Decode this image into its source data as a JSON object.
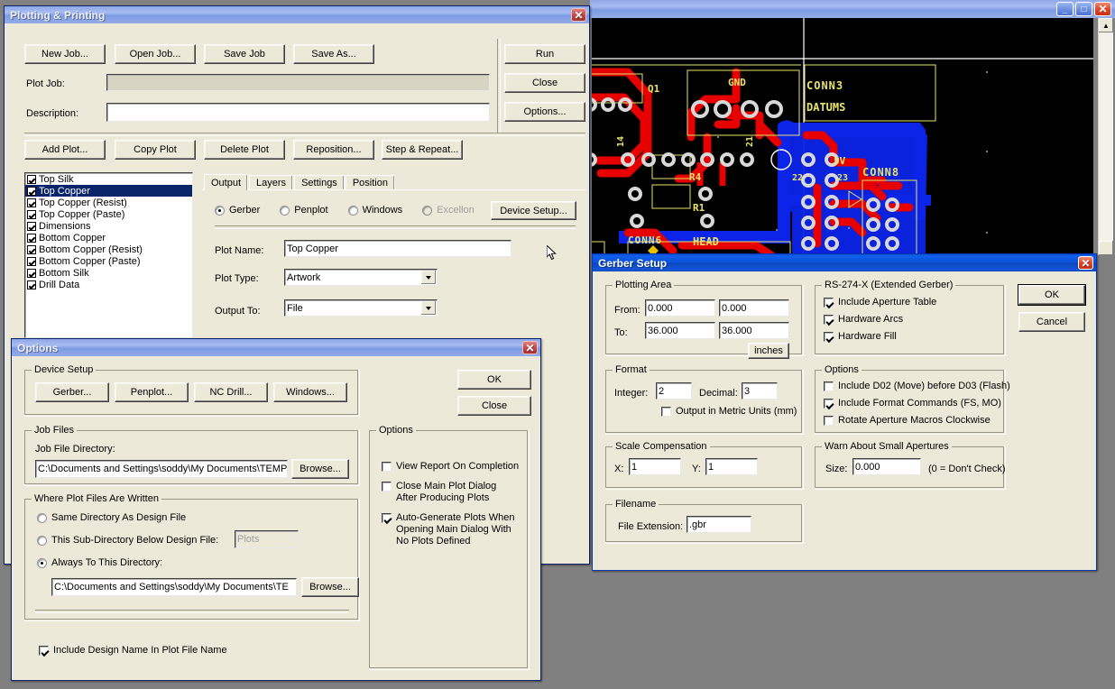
{
  "pcb_window": {
    "name": "pcb-design-window",
    "buttons": {
      "minimize": "_",
      "maximize": "□",
      "close": "✕"
    },
    "labels": [
      "Q1",
      "GND",
      "CONN3",
      "DATUMS",
      "14",
      "21",
      "22",
      "23",
      "5V",
      "CONN8",
      "R4",
      "R1",
      "CONN6",
      "HEAD"
    ]
  },
  "plotting": {
    "title": "Plotting & Printing",
    "close_label": "✕",
    "buttons": {
      "new_job": "New Job...",
      "open_job": "Open Job...",
      "save_job": "Save Job",
      "save_as": "Save As...",
      "run": "Run",
      "close": "Close",
      "options": "Options...",
      "add_plot": "Add Plot...",
      "copy_plot": "Copy Plot",
      "delete_plot": "Delete Plot",
      "reposition": "Reposition...",
      "step_repeat": "Step & Repeat..."
    },
    "fields": {
      "plot_job_label": "Plot Job:",
      "plot_job_value": "",
      "description_label": "Description:",
      "description_value": ""
    },
    "layers": [
      {
        "label": "Top Silk",
        "checked": true,
        "selected": false
      },
      {
        "label": "Top Copper",
        "checked": true,
        "selected": true
      },
      {
        "label": "Top Copper (Resist)",
        "checked": true,
        "selected": false
      },
      {
        "label": "Top Copper (Paste)",
        "checked": true,
        "selected": false
      },
      {
        "label": "Dimensions",
        "checked": true,
        "selected": false
      },
      {
        "label": "Bottom Copper",
        "checked": true,
        "selected": false
      },
      {
        "label": "Bottom Copper (Resist)",
        "checked": true,
        "selected": false
      },
      {
        "label": "Bottom Copper (Paste)",
        "checked": true,
        "selected": false
      },
      {
        "label": "Bottom Silk",
        "checked": true,
        "selected": false
      },
      {
        "label": "Drill Data",
        "checked": true,
        "selected": false
      }
    ],
    "tabs": [
      {
        "label": "Output",
        "selected": true
      },
      {
        "label": "Layers",
        "selected": false
      },
      {
        "label": "Settings",
        "selected": false
      },
      {
        "label": "Position",
        "selected": false
      }
    ],
    "output_tab": {
      "radios": [
        {
          "label": "Gerber",
          "selected": true,
          "disabled": false
        },
        {
          "label": "Penplot",
          "selected": false,
          "disabled": false
        },
        {
          "label": "Windows",
          "selected": false,
          "disabled": false
        },
        {
          "label": "Excellon",
          "selected": false,
          "disabled": true
        }
      ],
      "device_setup_button": "Device Setup...",
      "plot_name_label": "Plot Name:",
      "plot_name_value": "Top Copper",
      "plot_type_label": "Plot Type:",
      "plot_type_value": "Artwork",
      "output_to_label": "Output To:",
      "output_to_value": "File"
    }
  },
  "options_dialog": {
    "title": "Options",
    "close_label": "✕",
    "ok": "OK",
    "close": "Close",
    "device_setup": {
      "legend": "Device Setup",
      "gerber": "Gerber...",
      "penplot": "Penplot...",
      "nc_drill": "NC Drill...",
      "windows": "Windows..."
    },
    "job_files": {
      "legend": "Job Files",
      "dir_label": "Job File Directory:",
      "dir_value": "C:\\Documents and Settings\\soddy\\My Documents\\TEMP",
      "browse": "Browse..."
    },
    "where_written": {
      "legend": "Where Plot Files Are Written",
      "opt_same": "Same Directory As Design File",
      "opt_sub": "This Sub-Directory Below Design File:",
      "sub_value": "Plots",
      "opt_always": "Always To This Directory:",
      "always_value": "C:\\Documents and Settings\\soddy\\My Documents\\TE",
      "browse": "Browse...",
      "selected": "always"
    },
    "include_design_name": {
      "label": "Include Design Name In Plot File Name",
      "checked": true
    },
    "options_group": {
      "legend": "Options",
      "items": [
        {
          "label": "View Report On Completion",
          "checked": false
        },
        {
          "label": "Close Main Plot Dialog\nAfter Producing Plots",
          "checked": false
        },
        {
          "label": "Auto-Generate Plots When\nOpening Main Dialog With\nNo Plots Defined",
          "checked": true
        }
      ]
    }
  },
  "gerber_setup": {
    "title": "Gerber Setup",
    "close_label": "✕",
    "ok": "OK",
    "cancel": "Cancel",
    "plotting_area": {
      "legend": "Plotting Area",
      "from_label": "From:",
      "from_x": "0.000",
      "from_y": "0.000",
      "to_label": "To:",
      "to_x": "36.000",
      "to_y": "36.000",
      "units_button": "inches"
    },
    "format": {
      "legend": "Format",
      "integer_label": "Integer:",
      "integer_value": "2",
      "decimal_label": "Decimal:",
      "decimal_value": "3",
      "metric": {
        "label": "Output in Metric Units (mm)",
        "checked": false
      }
    },
    "scale_compensation": {
      "legend": "Scale Compensation",
      "x_label": "X:",
      "x_value": "1",
      "y_label": "Y:",
      "y_value": "1"
    },
    "filename": {
      "legend": "Filename",
      "ext_label": "File Extension:",
      "ext_value": ".gbr"
    },
    "rs274x": {
      "legend": "RS-274-X (Extended Gerber)",
      "items": [
        {
          "label": "Include Aperture Table",
          "checked": true
        },
        {
          "label": "Hardware Arcs",
          "checked": true
        },
        {
          "label": "Hardware Fill",
          "checked": true
        }
      ]
    },
    "options": {
      "legend": "Options",
      "items": [
        {
          "label": "Include D02 (Move) before D03 (Flash)",
          "checked": false
        },
        {
          "label": "Include Format Commands (FS, MO)",
          "checked": true
        },
        {
          "label": "Rotate Aperture Macros Clockwise",
          "checked": false
        }
      ]
    },
    "warn_small": {
      "legend": "Warn About Small Apertures",
      "size_label": "Size:",
      "size_value": "0.000",
      "hint": "(0 = Don't Check)"
    }
  }
}
